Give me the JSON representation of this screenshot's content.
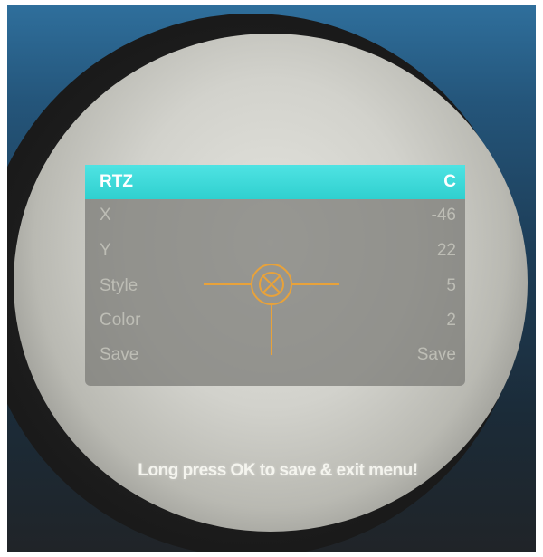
{
  "menu": {
    "selected": {
      "label": "RTZ",
      "value": "C"
    },
    "rows": [
      {
        "label": "X",
        "value": "-46"
      },
      {
        "label": "Y",
        "value": "22"
      },
      {
        "label": "Style",
        "value": "5"
      },
      {
        "label": "Color",
        "value": "2"
      },
      {
        "label": "Save",
        "value": "Save"
      }
    ]
  },
  "hint": "Long press OK to save & exit menu!",
  "colors": {
    "highlight": "#3fd8d8",
    "reticle": "#e8a23a",
    "menu_text": "#bdbdb5"
  },
  "icons": {
    "reticle": "crosshair-reticle-icon"
  }
}
